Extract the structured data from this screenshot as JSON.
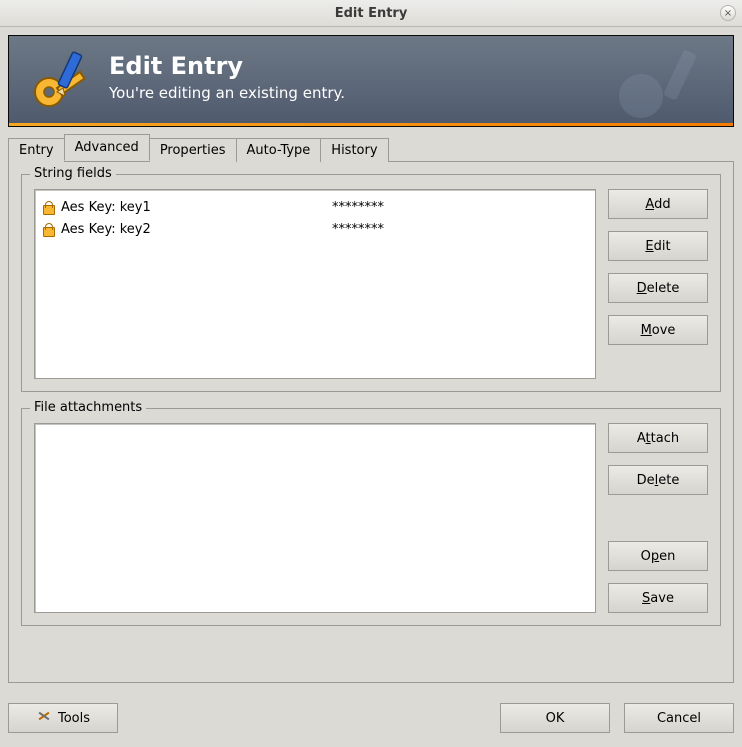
{
  "window": {
    "title": "Edit Entry"
  },
  "banner": {
    "heading": "Edit Entry",
    "subheading": "You're editing an existing entry."
  },
  "tabs": [
    {
      "label": "Entry",
      "selected": false
    },
    {
      "label": "Advanced",
      "selected": true
    },
    {
      "label": "Properties",
      "selected": false
    },
    {
      "label": "Auto-Type",
      "selected": false
    },
    {
      "label": "History",
      "selected": false
    }
  ],
  "string_fields": {
    "legend": "String fields",
    "items": [
      {
        "name": "Aes Key: key1",
        "value": "********"
      },
      {
        "name": "Aes Key: key2",
        "value": "********"
      }
    ],
    "buttons": {
      "add": {
        "label": "Add",
        "mnemonic": "A"
      },
      "edit": {
        "label": "Edit",
        "mnemonic": "E"
      },
      "delete": {
        "label": "Delete",
        "mnemonic": "D"
      },
      "move": {
        "label": "Move",
        "mnemonic": "M"
      }
    }
  },
  "file_attachments": {
    "legend": "File attachments",
    "items": [],
    "buttons": {
      "attach": {
        "label": "Attach",
        "mnemonic": "t"
      },
      "delete": {
        "label": "Delete",
        "mnemonic": "l"
      },
      "open": {
        "label": "Open",
        "mnemonic": "p"
      },
      "save": {
        "label": "Save",
        "mnemonic": "S"
      }
    }
  },
  "bottom": {
    "tools": "Tools",
    "ok": "OK",
    "cancel": "Cancel"
  },
  "icons": {
    "app": "key-pencil-icon",
    "tools": "tools-icon",
    "close": "close-icon",
    "lock": "lock-icon"
  }
}
